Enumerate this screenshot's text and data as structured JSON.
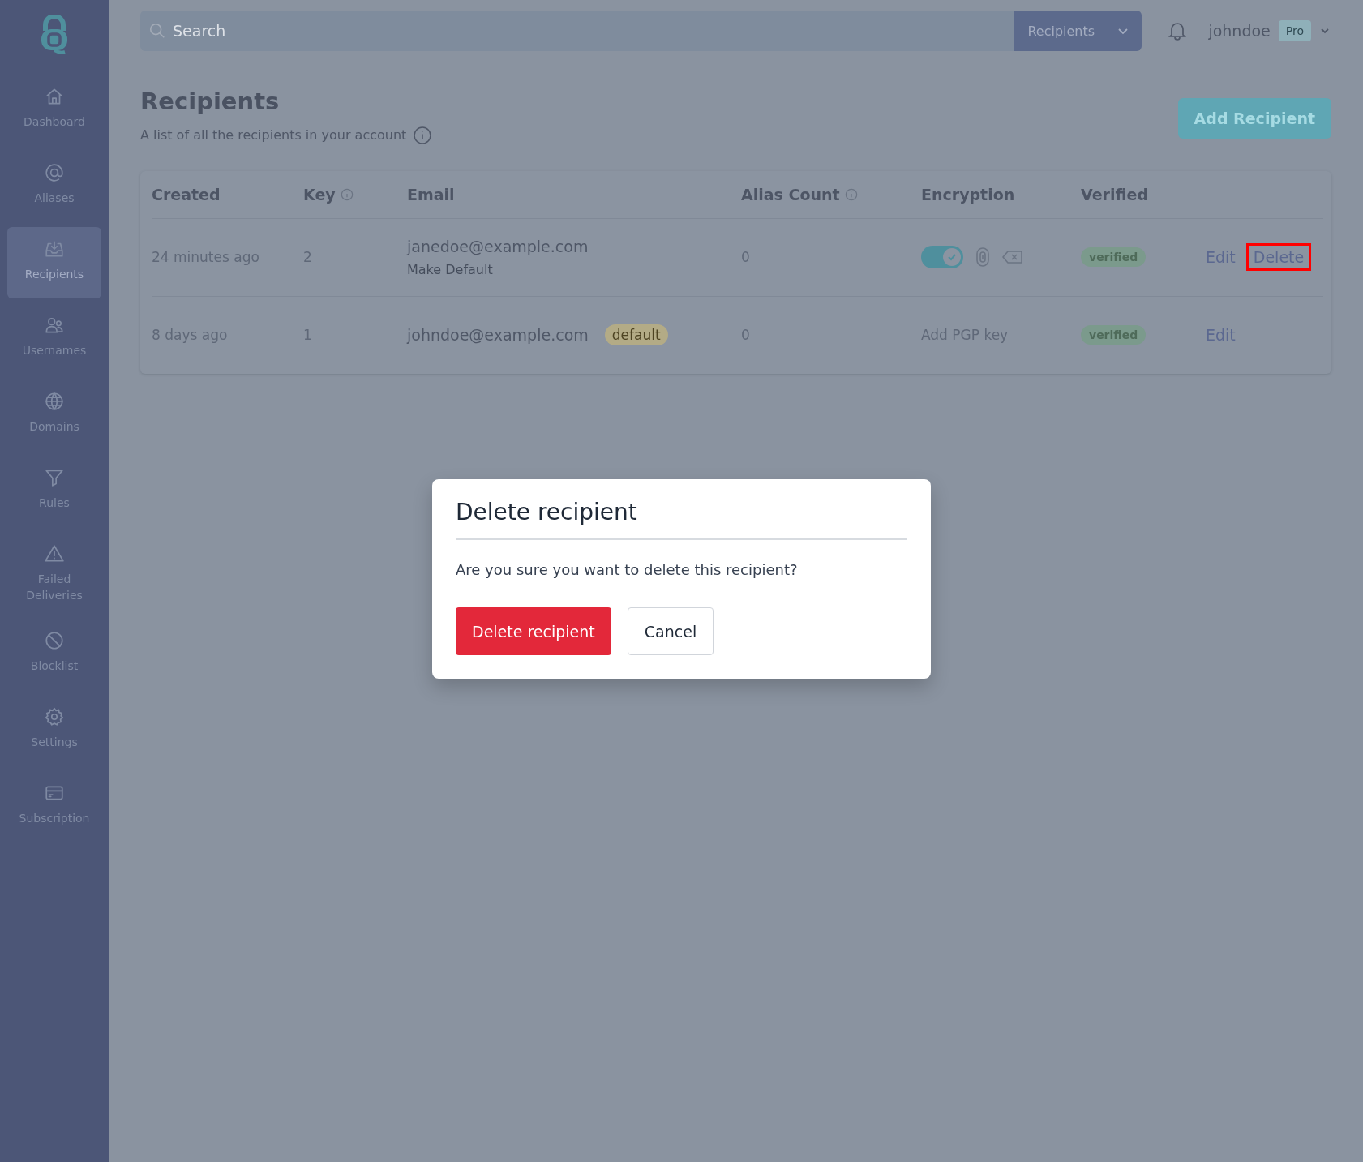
{
  "sidebar": {
    "items": [
      {
        "label": "Dashboard",
        "selected": false
      },
      {
        "label": "Aliases",
        "selected": false
      },
      {
        "label": "Recipients",
        "selected": true
      },
      {
        "label": "Usernames",
        "selected": false
      },
      {
        "label": "Domains",
        "selected": false
      },
      {
        "label": "Rules",
        "selected": false
      },
      {
        "label": "Failed Deliveries",
        "selected": false
      },
      {
        "label": "Blocklist",
        "selected": false
      },
      {
        "label": "Settings",
        "selected": false
      },
      {
        "label": "Subscription",
        "selected": false
      }
    ]
  },
  "header": {
    "search": {
      "placeholder": "Search"
    },
    "scope_dropdown": {
      "value": "Recipients"
    },
    "user": {
      "name": "johndoe",
      "plan": "Pro"
    }
  },
  "page": {
    "title": "Recipients",
    "subtitle": "A list of all the recipients in your account",
    "add_button": "Add Recipient"
  },
  "table": {
    "columns": [
      {
        "label": "Created",
        "info": false
      },
      {
        "label": "Key",
        "info": true
      },
      {
        "label": "Email",
        "info": false
      },
      {
        "label": "Alias Count",
        "info": true
      },
      {
        "label": "Encryption",
        "info": false
      },
      {
        "label": "Verified",
        "info": false
      }
    ],
    "rows": [
      {
        "created": "24 minutes ago",
        "key": "2",
        "email": "janedoe@example.com",
        "make_default": "Make Default",
        "alias_count": "0",
        "encryption": {
          "kind": "toggle",
          "on": true
        },
        "verified": "verified",
        "actions": [
          {
            "label": "Edit",
            "highlighted": false
          },
          {
            "label": "Delete",
            "highlighted": true
          }
        ]
      },
      {
        "created": "8 days ago",
        "key": "1",
        "email": "johndoe@example.com",
        "badge": "default",
        "alias_count": "0",
        "encryption": {
          "kind": "text",
          "text": "Add PGP key"
        },
        "verified": "verified",
        "actions": [
          {
            "label": "Edit",
            "highlighted": false
          }
        ]
      }
    ]
  },
  "dialog": {
    "title": "Delete recipient",
    "message": "Are you sure you want to delete this recipient?",
    "confirm": "Delete recipient",
    "cancel": "Cancel"
  }
}
